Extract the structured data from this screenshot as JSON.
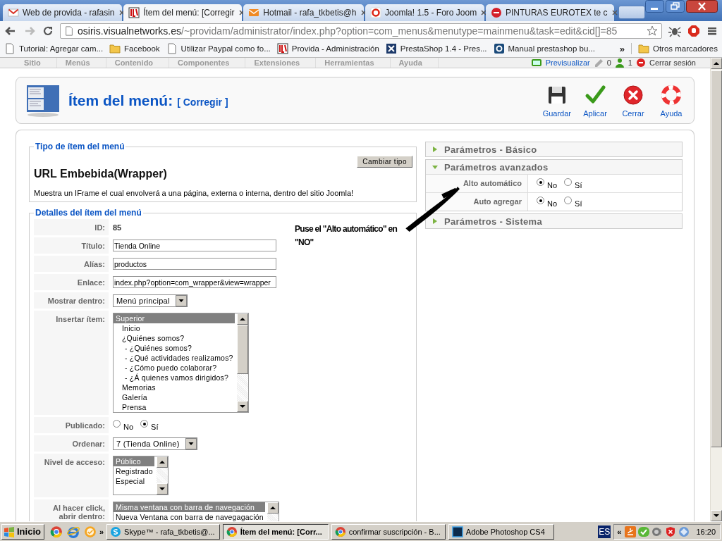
{
  "browser": {
    "tabs": [
      {
        "title": "Web de provida - rafasin",
        "kind": "mail",
        "selected": false
      },
      {
        "title": "Ítem del menú: [Corregir",
        "kind": "cms",
        "selected": true
      },
      {
        "title": "Hotmail - rafa_tkbetis@h",
        "kind": "hotmail",
        "selected": false
      },
      {
        "title": "Joomla! 1.5 - Foro Joom",
        "kind": "forum",
        "selected": false
      },
      {
        "title": "PINTURAS EUROTEX te c",
        "kind": "shop",
        "selected": false
      }
    ],
    "address": {
      "host": "osiris.visualnetworks.es",
      "path": "/~providam/administrator/index.php?option=com_menus&menutype=mainmenu&task=edit&cid[]=85"
    },
    "bookmarks": [
      {
        "label": "Tutorial: Agregar cam...",
        "kind": "page"
      },
      {
        "label": "Facebook",
        "kind": "folder"
      },
      {
        "label": "Utilizar Paypal como fo...",
        "kind": "page"
      },
      {
        "label": "Provida - Administración",
        "kind": "cms"
      },
      {
        "label": "PrestaShop 1.4 - Pres...",
        "kind": "presta"
      },
      {
        "label": "Manual prestashop bu...",
        "kind": "doc"
      }
    ],
    "bookmarks_more": "»",
    "other_bookmarks": "Otros marcadores"
  },
  "admin_menu": {
    "items": [
      "Sitio",
      "Menús",
      "Contenido",
      "Componentes",
      "Extensiones",
      "Herramientas",
      "Ayuda"
    ],
    "preview": "Previsualizar",
    "messages": "0",
    "users": "1",
    "logout": "Cerrar sesión"
  },
  "header": {
    "title": "Ítem del menú:",
    "subtitle": "[ Corregir ]",
    "toolbar": [
      {
        "label": "Guardar",
        "kind": "save"
      },
      {
        "label": "Aplicar",
        "kind": "apply"
      },
      {
        "label": "Cerrar",
        "kind": "cancel"
      },
      {
        "label": "Ayuda",
        "kind": "help"
      }
    ]
  },
  "type_section": {
    "legend": "Tipo de ítem del menú",
    "button": "Cambiar tipo",
    "name": "URL Embebida(Wrapper)",
    "description": "Muestra un IFrame el cual envolverá a una página, externa o interna, dentro del sitio Joomla!"
  },
  "form": {
    "legend": "Detalles del ítem del menú",
    "fields": [
      {
        "label": "ID:",
        "kind": "static",
        "value": "85"
      },
      {
        "label": "Título:",
        "kind": "input",
        "value": "Tienda Online"
      },
      {
        "label": "Alías:",
        "kind": "input",
        "value": "productos"
      },
      {
        "label": "Enlace:",
        "kind": "input",
        "value": "index.php?option=com_wrapper&view=wrapper"
      },
      {
        "label": "Mostrar dentro:",
        "kind": "select",
        "value": "Menú principal"
      },
      {
        "label": "Insertar ítem:",
        "kind": "list",
        "options": [
          {
            "text": "Superior",
            "selected": true,
            "children": [
              {
                "text": "Inicio",
                "selected": false
              },
              {
                "text": "¿Quiénes somos?",
                "selected": false,
                "children": [
                  {
                    "text": "- ¿Quiénes somos?",
                    "selected": false
                  },
                  {
                    "text": "- ¿Qué actividades realizamos?",
                    "selected": false
                  },
                  {
                    "text": "- ¿Cómo puedo colaborar?",
                    "selected": false
                  },
                  {
                    "text": "- ¿Á quienes vamos dirigidos?",
                    "selected": false
                  }
                ]
              },
              {
                "text": "Memorias",
                "selected": false
              },
              {
                "text": "Galería",
                "selected": false
              },
              {
                "text": "Prensa",
                "selected": false
              }
            ]
          }
        ]
      },
      {
        "label": "Publicado:",
        "kind": "radio",
        "options": [
          {
            "text": "No",
            "selected": false
          },
          {
            "text": "Sí",
            "selected": true
          }
        ]
      },
      {
        "label": "Ordenar:",
        "kind": "select",
        "value": "7 (Tienda Online)"
      },
      {
        "label": "Nivel de acceso:",
        "kind": "list",
        "options": [
          {
            "text": "Público",
            "selected": true
          },
          {
            "text": "Registrado",
            "selected": false
          },
          {
            "text": "Especial",
            "selected": false
          }
        ]
      },
      {
        "label": "Al hacer click, abrir dentro:",
        "kind": "list",
        "options": [
          {
            "text": "Misma ventana con barra de navegación",
            "selected": true
          },
          {
            "text": "Nueva Ventana con barra de navegagación",
            "selected": false
          }
        ]
      }
    ]
  },
  "annotation": {
    "text": "Puse el \"Alto automático\" en \"NO\""
  },
  "params": [
    {
      "title": "Parámetros - Básico",
      "expanded": false
    },
    {
      "title": "Parámetros avanzados",
      "expanded": true,
      "rows": [
        {
          "label": "Alto automático",
          "options": [
            {
              "text": "No",
              "selected": true
            },
            {
              "text": "Sí",
              "selected": false
            }
          ]
        },
        {
          "label": "Auto agregar",
          "options": [
            {
              "text": "No",
              "selected": true
            },
            {
              "text": "Sí",
              "selected": false
            }
          ]
        }
      ]
    },
    {
      "title": "Parámetros - Sistema",
      "expanded": false
    }
  ],
  "taskbar": {
    "start": "Inicio",
    "more": "»",
    "tasks": [
      {
        "label": "Skype™ - rafa_tkbetis@...",
        "kind": "skype",
        "selected": false
      },
      {
        "label": "Ítem del menú: [Corr...",
        "kind": "browser",
        "selected": true
      },
      {
        "label": "confirmar suscripción - B...",
        "kind": "browser",
        "selected": false
      },
      {
        "label": "Adobe Photoshop CS4",
        "kind": "photo",
        "selected": false
      }
    ],
    "language": "ES",
    "tray_toggle": "«",
    "clock": "16:20"
  }
}
